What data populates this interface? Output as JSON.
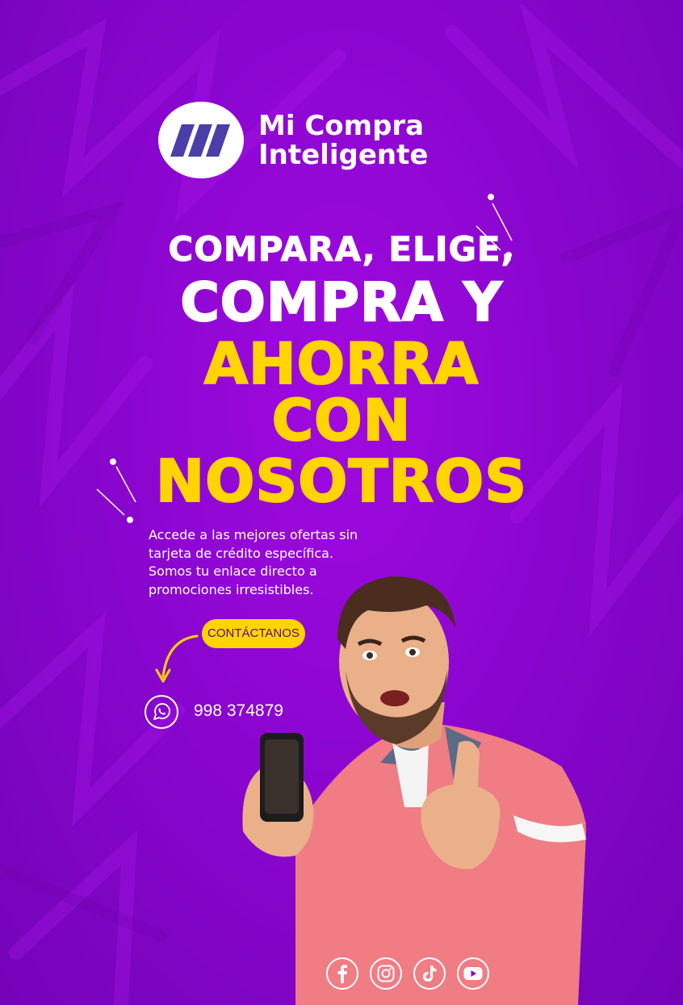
{
  "brand": {
    "line1": "Mi Compra",
    "line2": "Inteligente"
  },
  "headline": {
    "line1": "COMPARA, ELIGE,",
    "line2": "COMPRA Y",
    "line3": "AHORRA",
    "line4": "CON",
    "line5": "NOSOTROS"
  },
  "description": {
    "line1": "Accede a las mejores ofertas sin",
    "line2": "tarjeta de crédito específica.",
    "line3": "Somos tu enlace directo a",
    "line4": "promociones irresistibles."
  },
  "cta_label": "CONTÁCTANOS",
  "contact": {
    "phone": "998 374879",
    "icon": "whatsapp-icon"
  },
  "socials": [
    "facebook-icon",
    "instagram-icon",
    "tiktok-icon",
    "youtube-icon"
  ],
  "colors": {
    "background": "#8a06cf",
    "accent": "#ffd400",
    "text": "#ffffff",
    "logo_mark": "#4a3fa8"
  }
}
